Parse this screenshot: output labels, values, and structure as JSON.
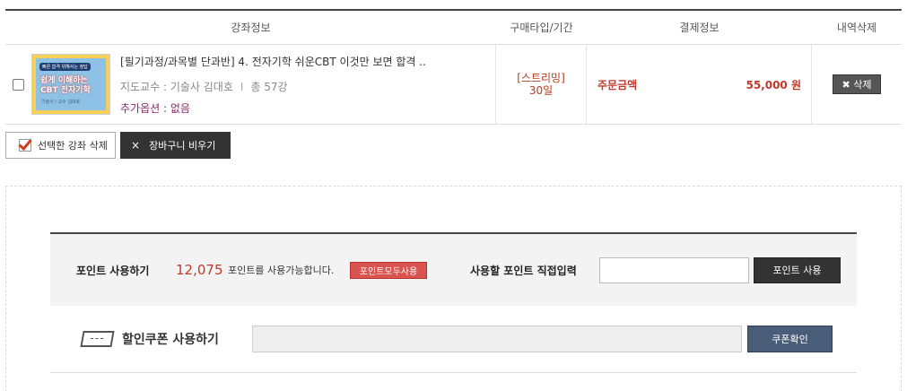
{
  "table": {
    "headers": {
      "course_info": "강좌정보",
      "purchase_type": "구매타입/기간",
      "payment_info": "결제정보",
      "delete": "내역삭제"
    },
    "rows": [
      {
        "thumb_top": "빠른 합격 위해서는 정답",
        "thumb_title_line1": "쉽게 이해하는",
        "thumb_title_line2": "CBT 전자기학",
        "thumb_sub": "기술사 / 교수 김대호",
        "title": "[필기과정/과목별 단과반] 4. 전자기학 쉬운CBT 이것만 보면 합격 ..",
        "teacher": "지도교수 : 기술사 김대호",
        "separator": "I",
        "lectures": "총 57강",
        "option": "추가옵션 : 없음",
        "type": "[스트리밍]",
        "period": "30일",
        "order_label": "주문금액",
        "price": "55,000 원",
        "delete_label": "✖ 삭제"
      }
    ]
  },
  "actions": {
    "delete_selected": "선택한 강좌 삭제",
    "clear_cart_icon": "×",
    "clear_cart": "장바구니 비우기"
  },
  "points": {
    "label": "포인트 사용하기",
    "value": "12,075",
    "text": "포인트를 사용가능합니다.",
    "use_all": "포인트모두사용",
    "direct_label": "사용할 포인트 직접입력",
    "input_value": "",
    "use_button": "포인트 사용"
  },
  "coupon": {
    "label": "할인쿠폰 사용하기",
    "input_value": "",
    "confirm_button": "쿠폰확인"
  },
  "icons": {
    "checkbox": "checkbox-icon",
    "check_mark": "check-mark-icon",
    "coupon": "coupon-ticket-icon"
  }
}
